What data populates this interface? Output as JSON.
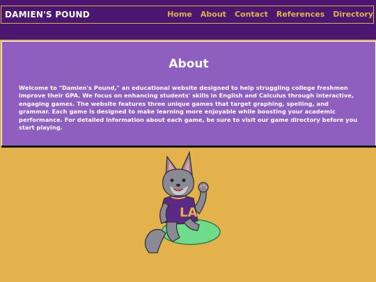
{
  "header": {
    "brand": "DAMIEN'S POUND",
    "nav": [
      {
        "label": "Home"
      },
      {
        "label": "About"
      },
      {
        "label": "Contact"
      },
      {
        "label": "References"
      },
      {
        "label": "Directory"
      }
    ]
  },
  "about": {
    "title": "About",
    "body": "Welcome to \"Damien's Pound,\" an educational website designed to help struggling college freshmen improve their GPA. We focus on enhancing students' skills in English and Calculus through interactive, engaging games. The website features three unique games that target graphing, spelling, and grammar. Each game is designed to make learning more enjoyable while boosting your academic performance. For detailed information about each game, be sure to visit our game directory before you start playing."
  },
  "mascot": {
    "shirt_letters": "LA"
  },
  "colors": {
    "nav_background": "#4a1670",
    "accent_gold": "#e3b24c",
    "about_panel": "#8f5fc0"
  }
}
